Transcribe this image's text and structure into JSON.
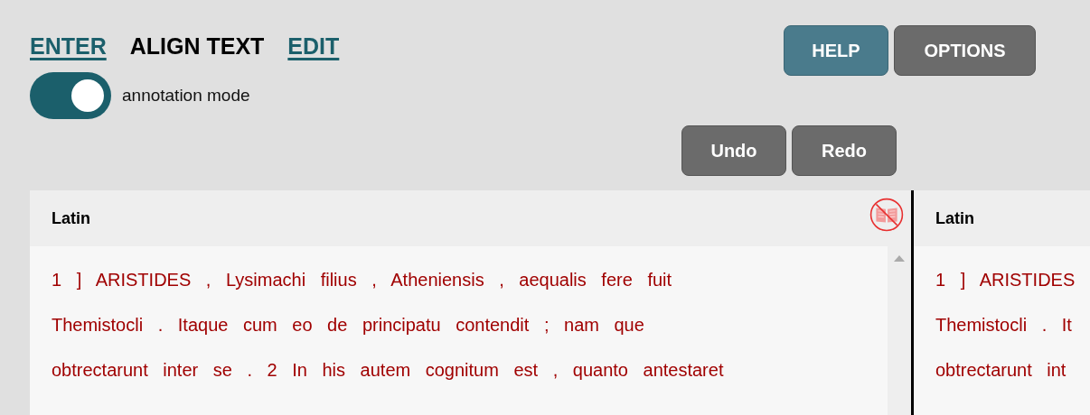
{
  "nav": [
    {
      "label": "ENTER",
      "selected": false
    },
    {
      "label": "ALIGN TEXT",
      "selected": true
    },
    {
      "label": "EDIT",
      "selected": false
    }
  ],
  "toggle": {
    "label": "annotation mode",
    "on": true
  },
  "top_buttons": [
    {
      "label": "HELP",
      "kind": "primary"
    },
    {
      "label": "OPTIONS",
      "kind": "secondary"
    }
  ],
  "edit_buttons": [
    {
      "label": "Undo"
    },
    {
      "label": "Redo"
    }
  ],
  "panes": [
    {
      "title": "Latin",
      "hide_icon": true,
      "scrollbar": true,
      "lines": [
        "1 ] ARISTIDES , Lysimachi filius , Atheniensis , aequalis fere fuit",
        "Themistocli . Itaque cum eo de principatu contendit ; nam que",
        "obtrectarunt inter se . 2 In his autem cognitum est , quanto antestaret"
      ]
    },
    {
      "title": "Latin",
      "hide_icon": false,
      "scrollbar": false,
      "lines": [
        "1 ] ARISTIDES",
        "Themistocli . It",
        "obtrectarunt int"
      ]
    }
  ]
}
